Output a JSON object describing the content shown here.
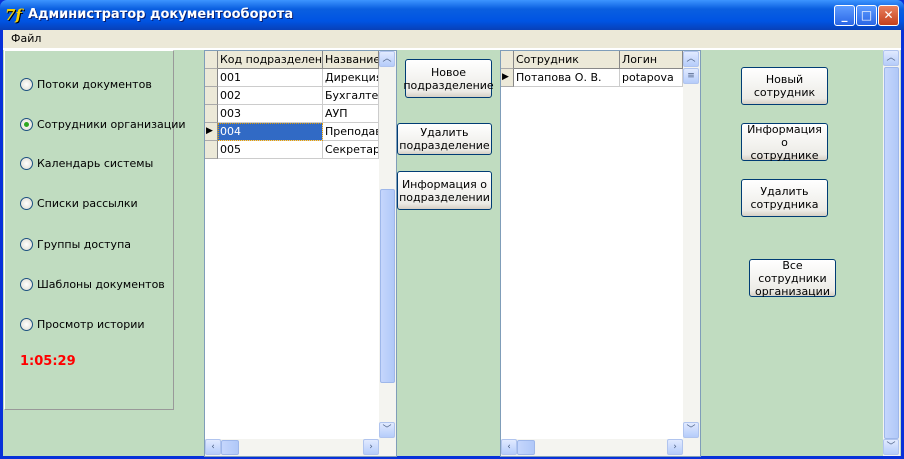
{
  "window": {
    "title": "Администратор документооборота",
    "icon_glyph": "7f",
    "minimize": "_",
    "maximize": "□",
    "close": "✕"
  },
  "menu": {
    "file": "Файл"
  },
  "nav": {
    "items": [
      {
        "label": "Потоки документов",
        "checked": false
      },
      {
        "label": "Сотрудники организации",
        "checked": true
      },
      {
        "label": "Календарь системы",
        "checked": false
      },
      {
        "label": "Списки рассылки",
        "checked": false
      },
      {
        "label": "Группы доступа",
        "checked": false
      },
      {
        "label": "Шаблоны документов",
        "checked": false
      },
      {
        "label": "Просмотр истории",
        "checked": false
      }
    ],
    "clock": "1:05:29"
  },
  "departments": {
    "columns": [
      "Код подразделения",
      "Название"
    ],
    "rows": [
      [
        "001",
        "Дирекция"
      ],
      [
        "002",
        "Бухгалтерия"
      ],
      [
        "003",
        "АУП"
      ],
      [
        "004",
        "Преподаватели"
      ],
      [
        "005",
        "Секретариат"
      ]
    ],
    "selected_index": 3
  },
  "dept_buttons": {
    "new": "Новое\nподразделение",
    "delete": "Удалить\nподразделение",
    "info": "Информация о\nподразделении"
  },
  "employees": {
    "columns": [
      "Сотрудник",
      "Логин"
    ],
    "rows": [
      [
        "Потапова  О. В.",
        "potapova"
      ]
    ],
    "selected_index": 0
  },
  "emp_buttons": {
    "new": "Новый\nсотрудник",
    "info": "Информация о\nсотруднике",
    "delete": "Удалить\nсотрудника",
    "all": "Все сотрудники\nорганизации"
  },
  "colors": {
    "client": "#c0dcc0",
    "clock": "#ff0000",
    "selection": "#316ac5"
  }
}
